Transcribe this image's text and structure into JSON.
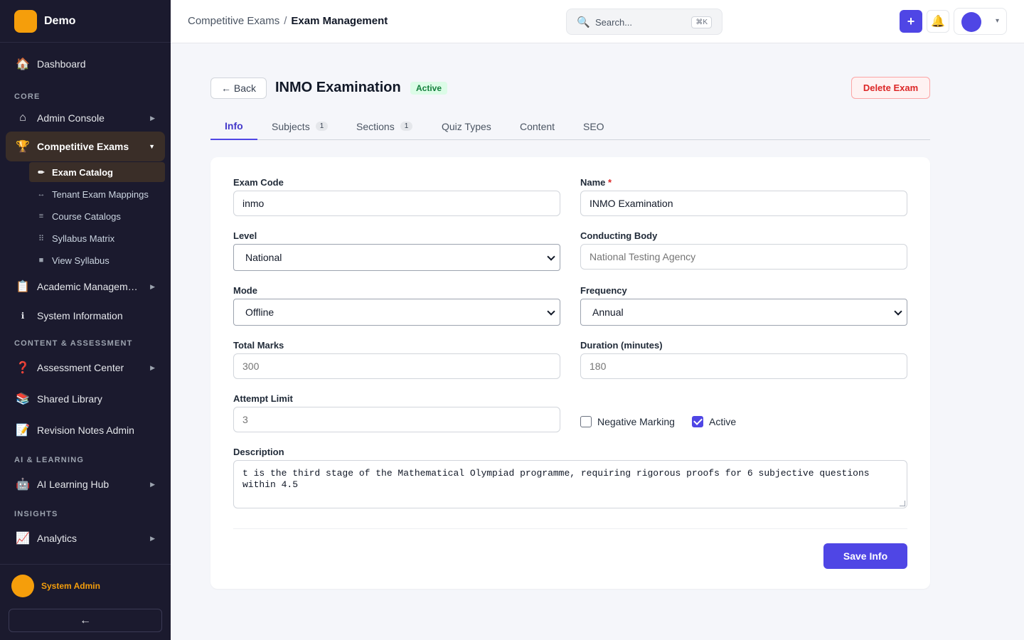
{
  "brand": {
    "name": "Demo",
    "logo_color": "#f59e0b"
  },
  "sidebar": {
    "dashboard": {
      "label": "Dashboard",
      "icon": "house-icon"
    },
    "sections": {
      "core": "CORE",
      "content": "CONTENT & ASSESSMENT",
      "ai": "AI & LEARNING",
      "insights": "INSIGHTS"
    },
    "admin_console": {
      "label": "Admin Console",
      "icon": "home-outline-icon"
    },
    "competitive_exams": {
      "label": "Competitive Exams",
      "icon": "trophy-icon"
    },
    "sub_items": [
      {
        "label": "Exam Catalog",
        "icon": "pencil-icon"
      },
      {
        "label": "Tenant Exam Mappings",
        "icon": "arrows-horizontal-icon"
      },
      {
        "label": "Course Catalogs",
        "icon": "list-icon"
      },
      {
        "label": "Syllabus Matrix",
        "icon": "grid-icon"
      },
      {
        "label": "View Syllabus",
        "icon": "square-icon"
      }
    ],
    "academic": {
      "label": "Academic Managem…",
      "icon": "clipboard-icon"
    },
    "system_info": {
      "label": "System Information",
      "icon": "info-icon"
    },
    "assessment": {
      "label": "Assessment Center",
      "icon": "question-icon"
    },
    "shared_library": {
      "label": "Shared Library",
      "icon": "books-icon"
    },
    "revision_notes": {
      "label": "Revision Notes Admin",
      "icon": "memo-icon"
    },
    "ai_hub": {
      "label": "AI Learning Hub",
      "icon": "robot-icon"
    },
    "analytics": {
      "label": "Analytics",
      "icon": "chart-icon"
    },
    "user": {
      "name": "System Admin"
    },
    "collapse": "←"
  },
  "topbar": {
    "breadcrumb": {
      "parent": "Competitive Exams",
      "separator": "/",
      "current": "Exam Management"
    },
    "search": {
      "placeholder": "Search...",
      "shortcut": "⌘K"
    },
    "add": "+",
    "user_caret": "▾"
  },
  "page": {
    "back_label": "← Back",
    "title": "INMO Examination",
    "status": "Active",
    "delete_label": "Delete Exam"
  },
  "tabs": [
    {
      "label": "Info",
      "active": true
    },
    {
      "label": "Subjects",
      "badge": "1"
    },
    {
      "label": "Sections",
      "badge": "1"
    },
    {
      "label": "Quiz Types"
    },
    {
      "label": "Content"
    },
    {
      "label": "SEO"
    }
  ],
  "form": {
    "exam_code": {
      "label": "Exam Code",
      "value": "inmo"
    },
    "name": {
      "label": "Name",
      "required": "*",
      "value": "INMO Examination"
    },
    "level": {
      "label": "Level",
      "value": "National"
    },
    "conducting_body": {
      "label": "Conducting Body",
      "placeholder": "National Testing Agency"
    },
    "mode": {
      "label": "Mode",
      "value": "Offline"
    },
    "frequency": {
      "label": "Frequency",
      "value": "Annual"
    },
    "total_marks": {
      "label": "Total Marks",
      "placeholder": "300"
    },
    "duration": {
      "label": "Duration (minutes)",
      "placeholder": "180"
    },
    "attempt_limit": {
      "label": "Attempt Limit",
      "placeholder": "3"
    },
    "negative_marking": {
      "label": "Negative Marking",
      "checked": false
    },
    "active": {
      "label": "Active",
      "checked": true
    },
    "description": {
      "label": "Description",
      "value": "t is the third stage of the Mathematical Olympiad programme, requiring rigorous proofs for 6 subjective questions within 4.5"
    },
    "save_label": "Save Info"
  },
  "colors": {
    "accent": "#4f46e5",
    "sidebar_bg": "#1b1a2e",
    "danger": "#dc2626",
    "success_bg": "#dcfce7"
  }
}
